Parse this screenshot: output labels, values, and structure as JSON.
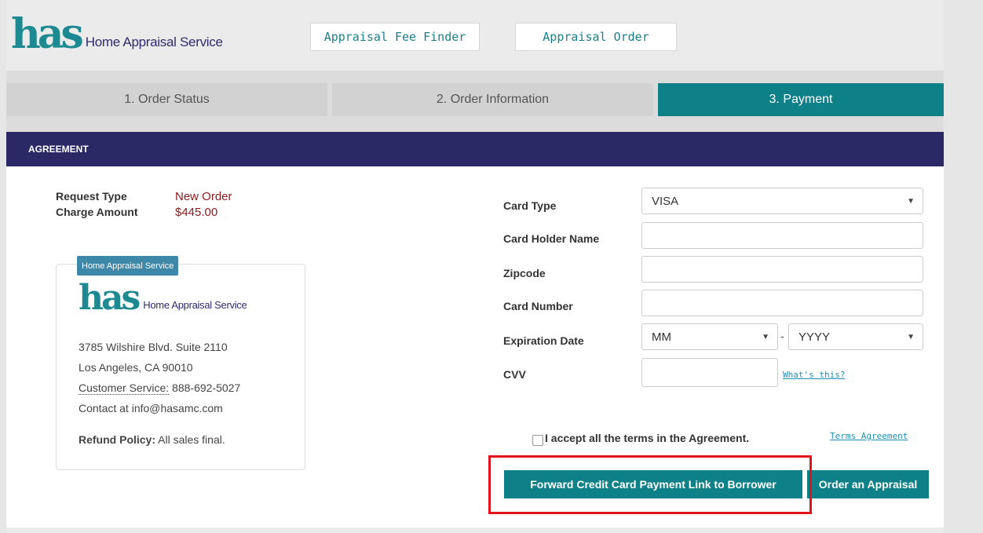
{
  "header": {
    "logo_mark": "has",
    "logo_text": "Home Appraisal Service",
    "nav": [
      {
        "label": "Appraisal Fee Finder"
      },
      {
        "label": "Appraisal Order"
      }
    ]
  },
  "tabs": [
    {
      "label": "1. Order Status",
      "active": false
    },
    {
      "label": "2. Order Information",
      "active": false
    },
    {
      "label": "3. Payment",
      "active": true
    }
  ],
  "section_title": "AGREEMENT",
  "summary": {
    "request_type_label": "Request Type",
    "request_type_value": "New Order",
    "charge_amount_label": "Charge Amount",
    "charge_amount_value": "$445.00"
  },
  "company_card": {
    "tag": "Home Appraisal Service",
    "logo_mark": "has",
    "logo_text": "Home Appraisal Service",
    "address_line1": "3785 Wilshire Blvd. Suite 2110",
    "address_line2": "Los Angeles, CA 90010",
    "customer_service_label": "Customer Service:",
    "customer_service_phone": "888-692-5027",
    "contact": "Contact at info@hasamc.com",
    "refund_label": "Refund Policy:",
    "refund_value": "All sales final."
  },
  "form": {
    "card_type_label": "Card Type",
    "card_type_value": "VISA",
    "card_holder_label": "Card Holder Name",
    "card_holder_value": "",
    "zipcode_label": "Zipcode",
    "zipcode_value": "",
    "card_number_label": "Card Number",
    "card_number_value": "",
    "expiration_label": "Expiration Date",
    "exp_month_value": "MM",
    "exp_separator": "-",
    "exp_year_value": "YYYY",
    "cvv_label": "CVV",
    "cvv_value": "",
    "whats_this": "What's this?",
    "accept_terms": "I accept all the terms in the Agreement.",
    "terms_link": "Terms Agreement",
    "forward_button": "Forward Credit Card Payment Link to Borrower",
    "order_button": "Order an Appraisal"
  },
  "colors": {
    "accent_teal": "#0e8087",
    "navy": "#2b2965",
    "highlight_red": "#e4111a"
  }
}
